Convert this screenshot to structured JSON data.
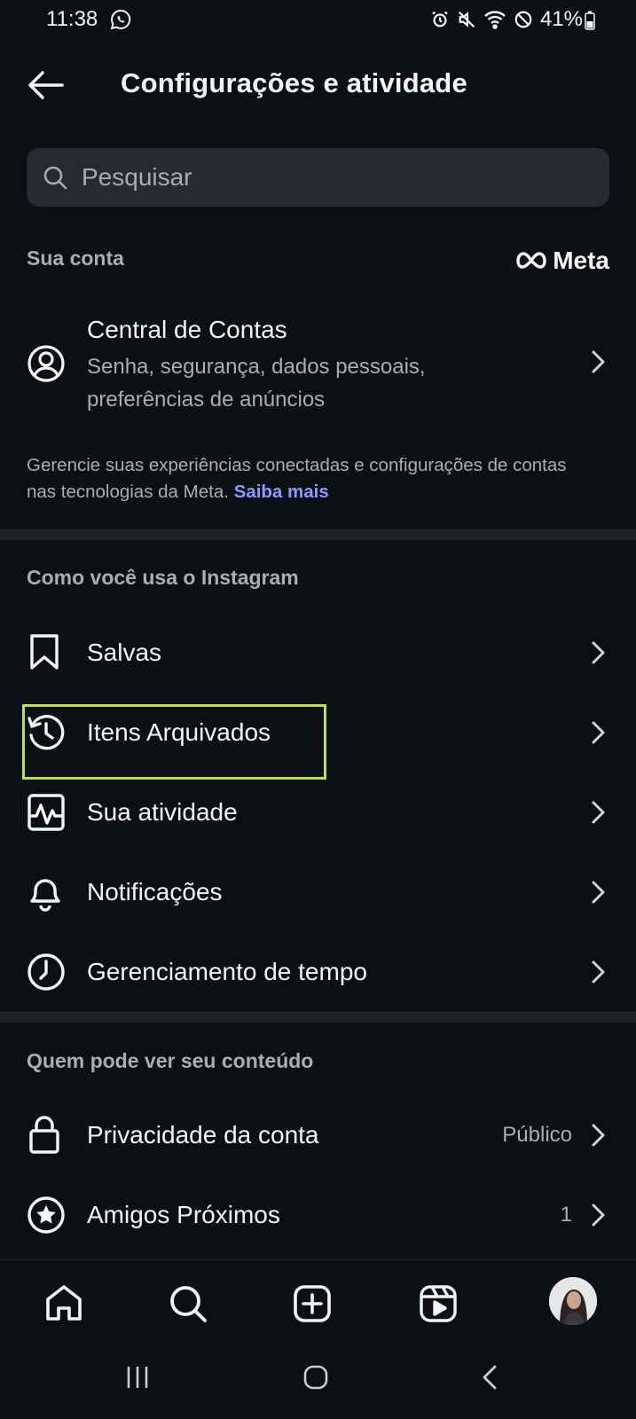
{
  "status_bar": {
    "time": "11:38",
    "battery": "41%"
  },
  "header": {
    "title": "Configurações e atividade"
  },
  "search": {
    "placeholder": "Pesquisar"
  },
  "your_account": {
    "label": "Sua conta",
    "meta_logo": "Meta",
    "accounts_center": {
      "title": "Central de Contas",
      "subtitle_line1": "Senha, segurança, dados pessoais,",
      "subtitle_line2": "preferências de anúncios"
    },
    "note_text": "Gerencie suas experiências conectadas e configurações de contas nas tecnologias da Meta.",
    "note_link": "Saiba mais"
  },
  "how_you_use": {
    "label": "Como você usa o Instagram",
    "items": [
      {
        "label": "Salvas",
        "icon": "bookmark-icon"
      },
      {
        "label": "Itens Arquivados",
        "icon": "archive-history-icon"
      },
      {
        "label": "Sua atividade",
        "icon": "activity-icon"
      },
      {
        "label": "Notificações",
        "icon": "bell-icon"
      },
      {
        "label": "Gerenciamento de tempo",
        "icon": "clock-icon"
      }
    ]
  },
  "who_can_see": {
    "label": "Quem pode ver seu conteúdo",
    "items": [
      {
        "label": "Privacidade da conta",
        "value": "Público",
        "icon": "lock-icon"
      },
      {
        "label": "Amigos Próximos",
        "value": "1",
        "icon": "star-circle-icon"
      }
    ]
  },
  "bottom_tabs": [
    "home-icon",
    "search-icon",
    "create-icon",
    "reels-icon",
    "profile-avatar"
  ],
  "colors": {
    "background": "#0c0f14",
    "highlight": "#b8e34a",
    "link": "#8c9bff"
  }
}
